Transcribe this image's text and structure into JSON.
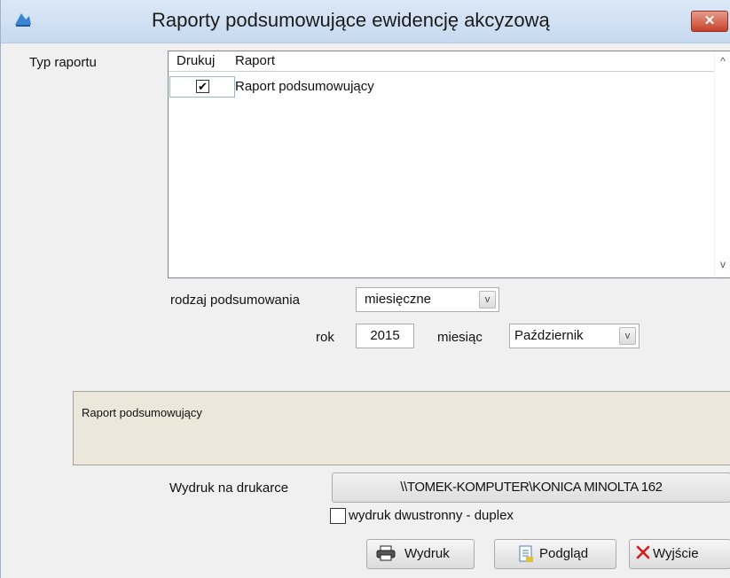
{
  "window": {
    "title": "Raporty podsumowujące ewidencję akcyzową",
    "app_icon": "app-logo-icon",
    "close_icon": "close-icon",
    "close_glyph": "✕"
  },
  "report_type": {
    "label": "Typ raportu",
    "columns": [
      "Drukuj",
      "Raport"
    ],
    "rows": [
      {
        "checked": true,
        "name": "Raport podsumowujący"
      }
    ],
    "scroll_up": "^",
    "scroll_down": "v"
  },
  "summary": {
    "label": "rodzaj podsumowania",
    "value": "miesięczne"
  },
  "year": {
    "label": "rok",
    "value": "2015"
  },
  "month": {
    "label": "miesiąc",
    "value": "Październik"
  },
  "description": {
    "text": "Raport podsumowujący"
  },
  "printer": {
    "label": "Wydruk na drukarce",
    "name": "\\\\TOMEK-KOMPUTER\\KONICA MINOLTA 162"
  },
  "duplex": {
    "label": "wydruk dwustronny - duplex",
    "checked": false
  },
  "buttons": {
    "print": {
      "label": "Wydruk",
      "icon": "printer-icon"
    },
    "preview": {
      "label": "Podgląd",
      "icon": "preview-document-icon"
    },
    "exit": {
      "label": "Wyjście",
      "icon": "red-x-icon"
    }
  },
  "dropdown_glyph": "v",
  "check_glyph": "✔",
  "colors": {
    "titlebar": "#c7d9ef",
    "close_button": "#c8412b",
    "description_bg": "#ebe8db",
    "exit_icon": "#d11a1a"
  }
}
